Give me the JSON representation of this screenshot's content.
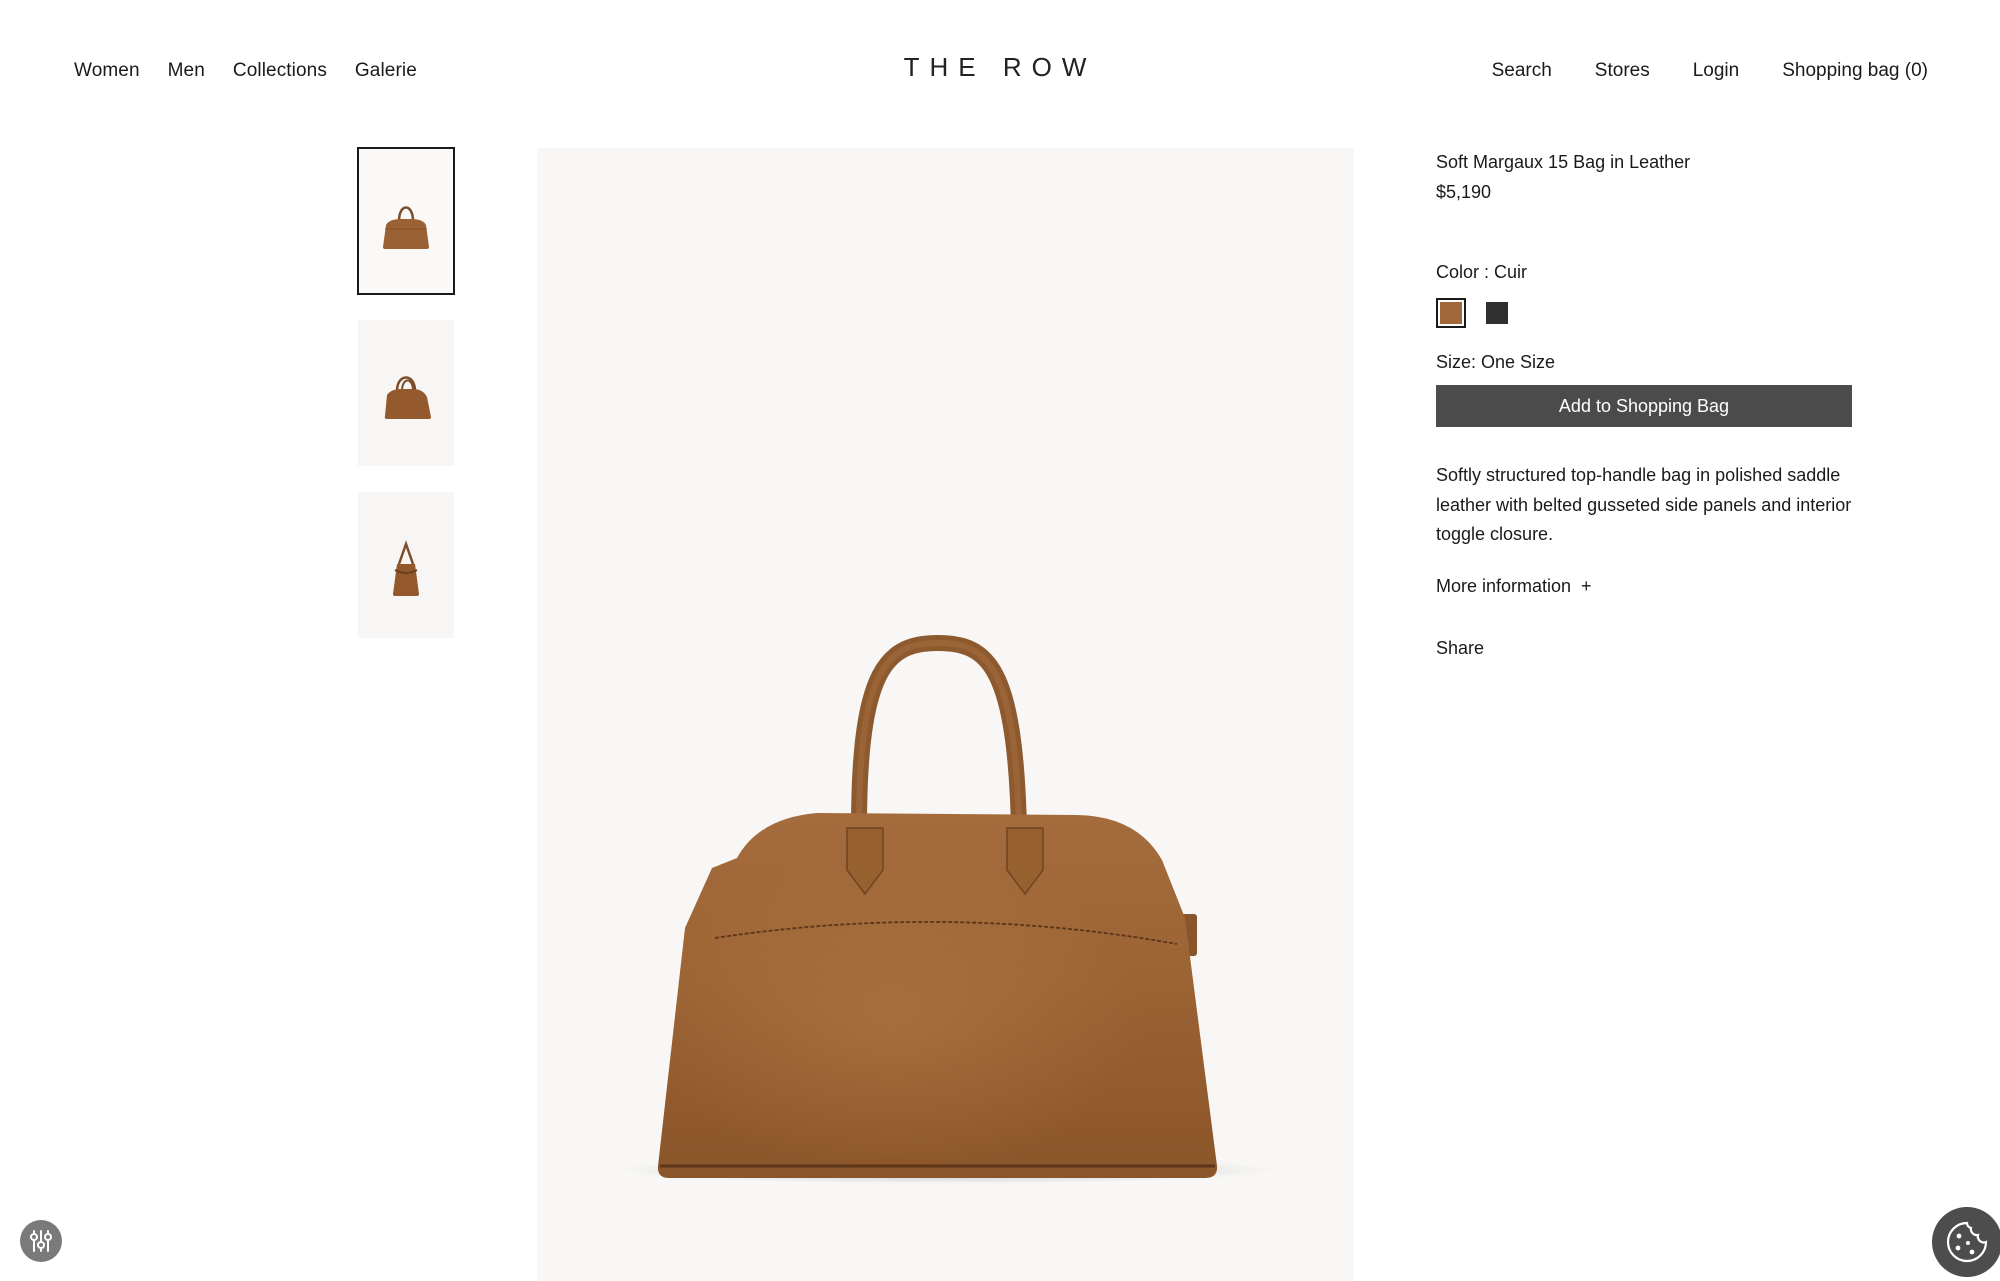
{
  "header": {
    "logo": "THE ROW",
    "nav_left": [
      "Women",
      "Men",
      "Collections",
      "Galerie"
    ],
    "nav_right": [
      "Search",
      "Stores",
      "Login",
      "Shopping bag (0)"
    ]
  },
  "gallery": {
    "thumbnails": [
      {
        "icon": "bag-front-thumbnail",
        "active": true
      },
      {
        "icon": "bag-angle-thumbnail",
        "active": false
      },
      {
        "icon": "bag-side-thumbnail",
        "active": false
      }
    ],
    "main_image": "bag-front-image"
  },
  "product": {
    "title": "Soft Margaux 15 Bag in Leather",
    "price": "$5,190",
    "color_label": "Color : Cuir",
    "colors": [
      {
        "name": "Cuir",
        "hex": "#a0673a",
        "selected": true
      },
      {
        "name": "Black",
        "hex": "#2f2f2f",
        "selected": false
      }
    ],
    "size_label": "Size: One Size",
    "add_button": "Add to Shopping Bag",
    "description": "Softly structured top-handle bag in polished saddle leather with belted gusseted side panels and interior toggle closure.",
    "more_info": "More information  +",
    "share": "Share"
  },
  "colors": {
    "button_bg": "#4b4b4b",
    "leather": "#9a6234",
    "image_bg": "#f8f7f5"
  },
  "floating": {
    "settings_icon": "sliders-icon",
    "cookie_icon": "cookie-icon"
  }
}
